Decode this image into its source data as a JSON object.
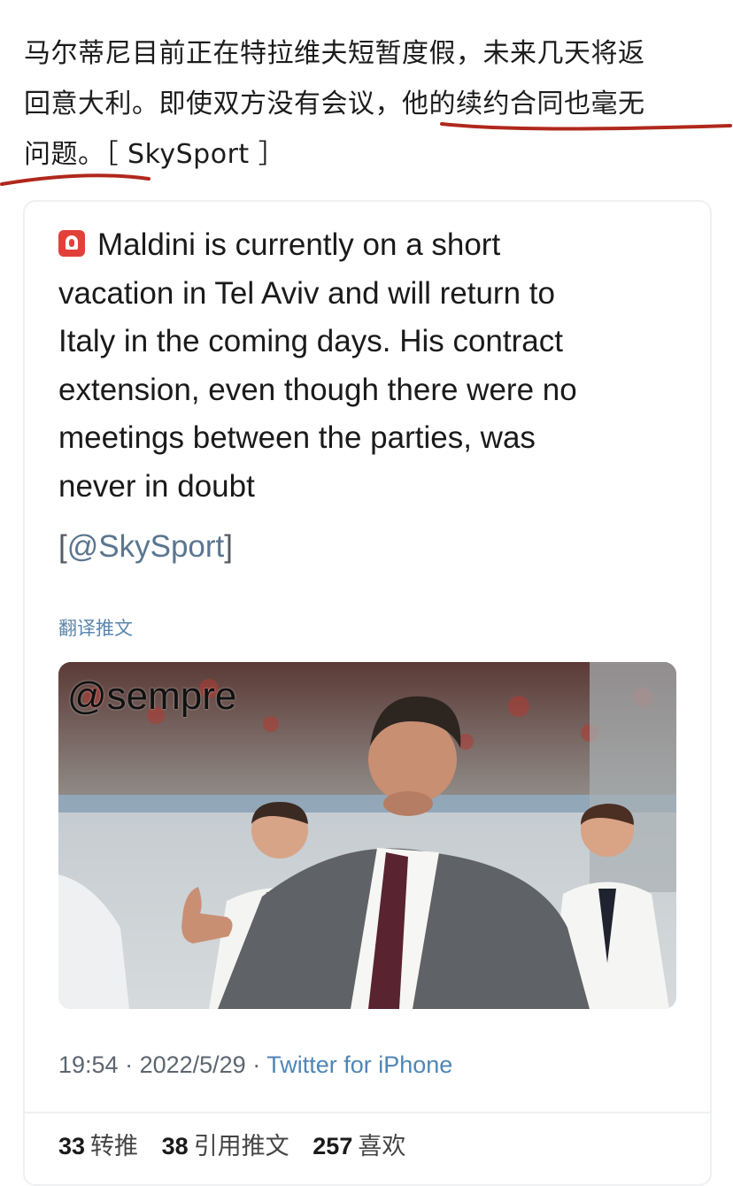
{
  "headline": {
    "line1": "马尔蒂尼目前正在特拉维夫短暂度假，未来几天将返",
    "line2": "回意大利。即使双方没有会议，他的续约合同也毫无",
    "line3": "问题。［ SkySport ］"
  },
  "tweet": {
    "icon": "siren-icon",
    "lines": [
      "Maldini is currently on a short",
      "vacation in Tel Aviv and will return to",
      "Italy in the coming days. His contract",
      "extension, even though there were no",
      "meetings between the parties, was",
      "never in doubt"
    ],
    "handle_open": "[",
    "handle": "@SkySport",
    "handle_close": "]",
    "translate_label": "翻译推文",
    "image_watermark": "@sempre",
    "time": "19:54",
    "date": "2022/5/29",
    "source": "Twitter for iPhone",
    "sep": " · ",
    "stats": {
      "retweets": "33",
      "retweets_label": "转推",
      "quotes": "38",
      "quotes_label": "引用推文",
      "likes": "257",
      "likes_label": "喜欢"
    }
  },
  "colors": {
    "underline": "#b0281c",
    "link": "#4f86b7",
    "siren": "#e2413a"
  }
}
